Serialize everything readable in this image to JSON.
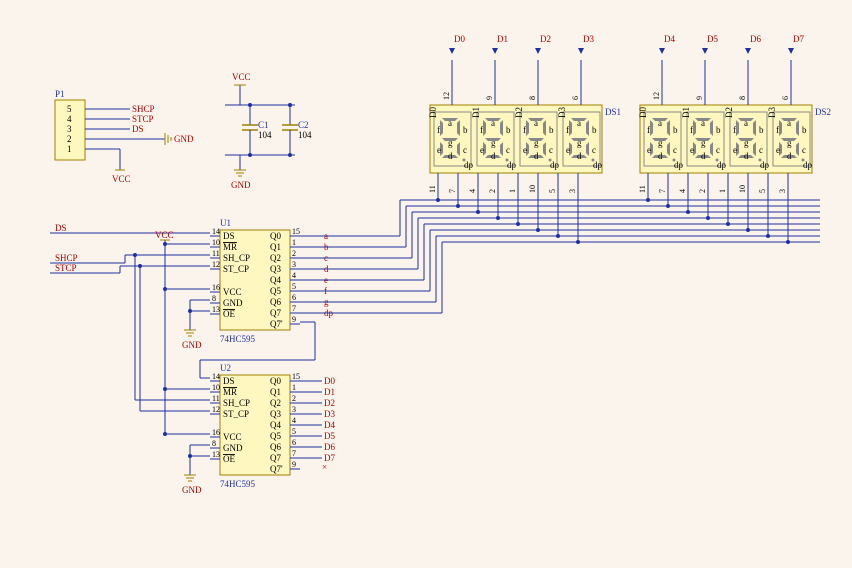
{
  "connector": {
    "ref": "P1",
    "pins": [
      "5",
      "4",
      "3",
      "2",
      "1"
    ],
    "nets": [
      "SHCP",
      "STCP",
      "DS",
      "GND",
      "VCC"
    ]
  },
  "caps": {
    "power_top": "VCC",
    "power_bot": "GND",
    "c1": {
      "ref": "C1",
      "val": "104"
    },
    "c2": {
      "ref": "C2",
      "val": "104"
    }
  },
  "u1": {
    "ref": "U1",
    "part": "74HC595",
    "left_pins": [
      {
        "num": "14",
        "name": "DS"
      },
      {
        "num": "10",
        "name": "MR",
        "ol": true
      },
      {
        "num": "11",
        "name": "SH_CP"
      },
      {
        "num": "12",
        "name": "ST_CP"
      },
      {
        "num": "16",
        "name": "VCC"
      },
      {
        "num": "8",
        "name": "GND"
      },
      {
        "num": "13",
        "name": "OE",
        "ol": true
      }
    ],
    "right_pins": [
      {
        "num": "15",
        "name": "Q0",
        "net": "a"
      },
      {
        "num": "1",
        "name": "Q1",
        "net": "b"
      },
      {
        "num": "2",
        "name": "Q2",
        "net": "c"
      },
      {
        "num": "3",
        "name": "Q3",
        "net": "d"
      },
      {
        "num": "4",
        "name": "Q4",
        "net": "e"
      },
      {
        "num": "5",
        "name": "Q5",
        "net": "f"
      },
      {
        "num": "6",
        "name": "Q6",
        "net": "g"
      },
      {
        "num": "7",
        "name": "Q7",
        "net": "dp"
      },
      {
        "num": "9",
        "name": "Q7'"
      }
    ]
  },
  "u2": {
    "ref": "U2",
    "part": "74HC595",
    "left_pins": [
      {
        "num": "14",
        "name": "DS"
      },
      {
        "num": "10",
        "name": "MR",
        "ol": true
      },
      {
        "num": "11",
        "name": "SH_CP"
      },
      {
        "num": "12",
        "name": "ST_CP"
      },
      {
        "num": "16",
        "name": "VCC"
      },
      {
        "num": "8",
        "name": "GND"
      },
      {
        "num": "13",
        "name": "OE",
        "ol": true
      }
    ],
    "right_pins": [
      {
        "num": "15",
        "name": "Q0",
        "net": "D0"
      },
      {
        "num": "1",
        "name": "Q1",
        "net": "D1"
      },
      {
        "num": "2",
        "name": "Q2",
        "net": "D2"
      },
      {
        "num": "3",
        "name": "Q3",
        "net": "D3"
      },
      {
        "num": "4",
        "name": "Q4",
        "net": "D4"
      },
      {
        "num": "5",
        "name": "Q5",
        "net": "D5"
      },
      {
        "num": "6",
        "name": "Q6",
        "net": "D6"
      },
      {
        "num": "7",
        "name": "Q7",
        "net": "D7"
      },
      {
        "num": "9",
        "name": "Q7'"
      }
    ]
  },
  "displays": {
    "ds1": {
      "ref": "DS1",
      "top_nets": [
        "D0",
        "D1",
        "D2",
        "D3"
      ],
      "top_pins": [
        "12",
        "9",
        "8",
        "6"
      ],
      "bot_pins": [
        "11",
        "7",
        "4",
        "2",
        "1",
        "10",
        "5",
        "3"
      ],
      "digit_labels": [
        "D0",
        "D1",
        "D2",
        "D3"
      ]
    },
    "ds2": {
      "ref": "DS2",
      "top_nets": [
        "D4",
        "D5",
        "D6",
        "D7"
      ],
      "top_pins": [
        "12",
        "9",
        "8",
        "6"
      ],
      "bot_pins": [
        "11",
        "7",
        "4",
        "2",
        "1",
        "10",
        "5",
        "3"
      ],
      "digit_labels": [
        "D0",
        "D1",
        "D2",
        "D3"
      ]
    },
    "seg_labels": [
      "a",
      "b",
      "c",
      "d",
      "e",
      "f",
      "g",
      "dp"
    ]
  },
  "input_nets": {
    "ds": "DS",
    "shcp": "SHCP",
    "stcp": "STCP",
    "vcc": "VCC",
    "gnd": "GND"
  },
  "nc": "×"
}
